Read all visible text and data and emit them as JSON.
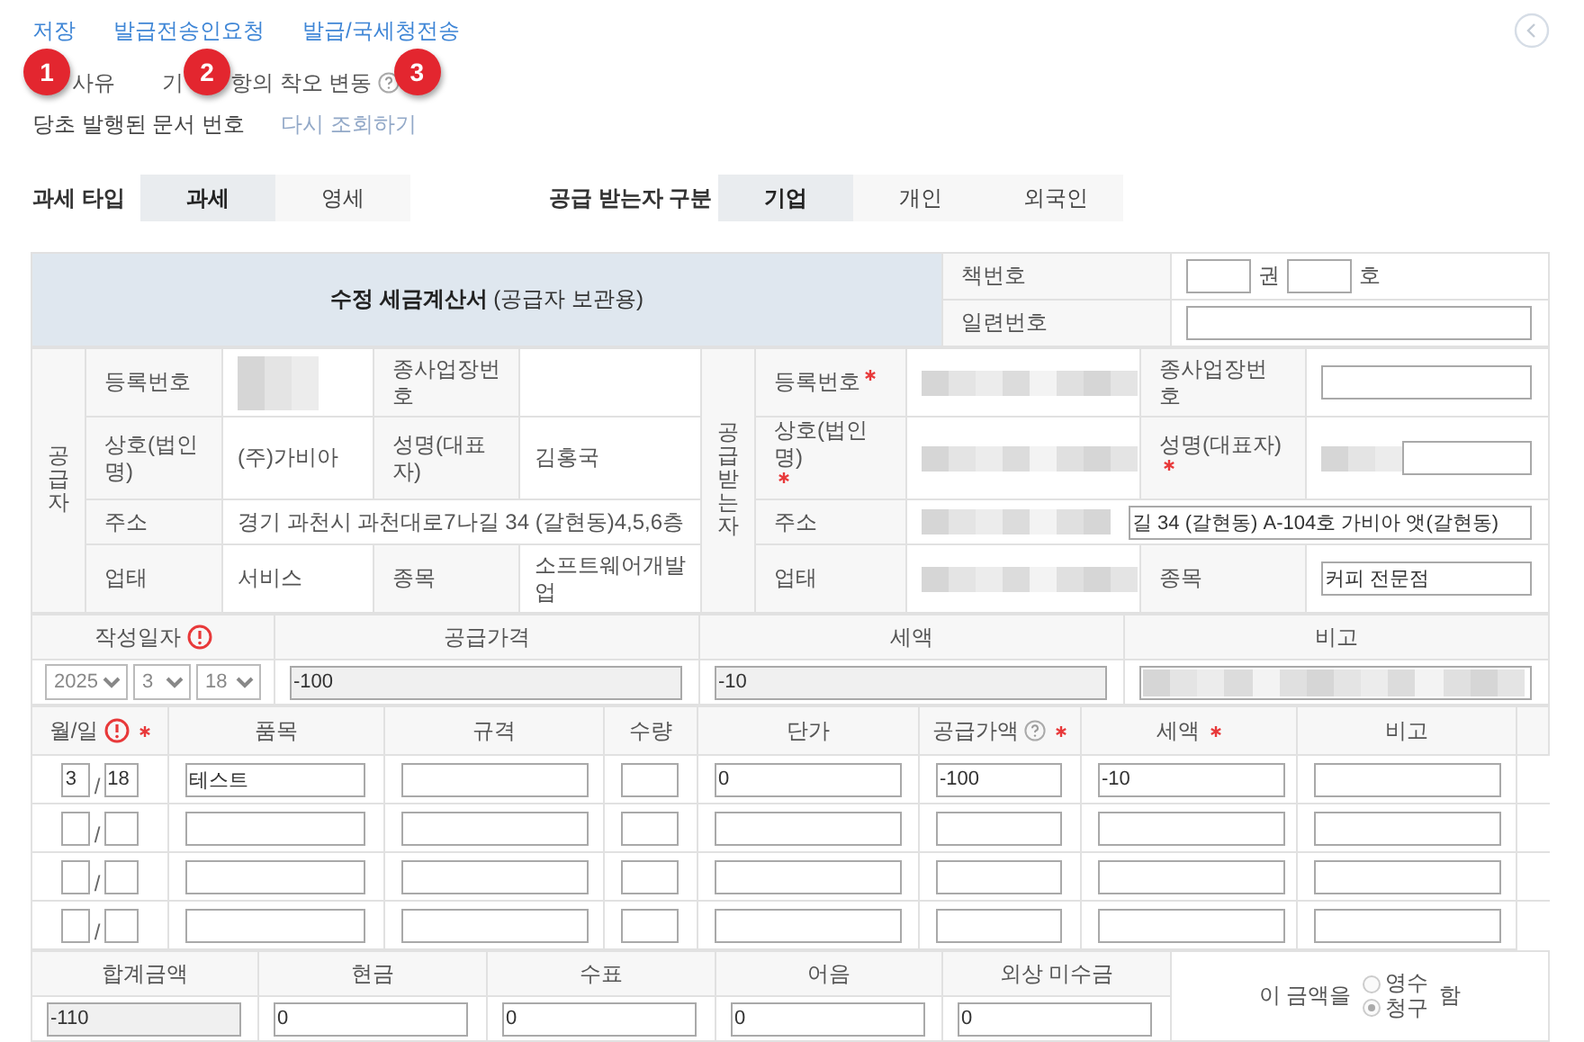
{
  "actions": [
    {
      "label": "저장"
    },
    {
      "label": "발급전송인요청"
    },
    {
      "label": "발급/국세청전송"
    }
  ],
  "callouts": [
    "1",
    "2",
    "3"
  ],
  "reason": {
    "texts": [
      "사유",
      "기",
      "항의 착오 변동"
    ],
    "help": true
  },
  "original_document": {
    "label": "당초 발행된 문서 번호",
    "link": "다시 조회하기"
  },
  "tax_type": {
    "label": "과세 타입",
    "options": [
      {
        "label": "과세",
        "selected": true
      },
      {
        "label": "영세",
        "selected": false
      }
    ]
  },
  "recipient_type": {
    "label": "공급 받는자 구분",
    "options": [
      {
        "label": "기업",
        "selected": true
      },
      {
        "label": "개인",
        "selected": false
      },
      {
        "label": "외국인",
        "selected": false
      }
    ]
  },
  "invoice": {
    "title": "**수정 세금계산서** (공급자 보관용)",
    "book_number": {
      "label": "책번호",
      "unit_1": "권",
      "unit_2": "호"
    },
    "serial_number": {
      "label": "일련번호"
    },
    "supplier": {
      "heading": "공급자",
      "rows": [
        [
          {
            "label": "등록번호",
            "kind": "blurred",
            "required": false
          },
          {
            "label": "종사업장번호",
            "kind": "empty",
            "required": false
          }
        ],
        [
          {
            "label": "상호(법인명)",
            "kind": "text",
            "value": "(주)가비아",
            "required": false
          },
          {
            "label": "성명(대표자)",
            "kind": "text",
            "value": "김홍국",
            "required": false
          }
        ],
        [
          {
            "label": "주소",
            "kind": "text",
            "value": "경기 과천시 과천대로7나길 34 (갈현동)4,5,6층",
            "required": false
          }
        ],
        [
          {
            "label": "업태",
            "kind": "text",
            "value": "서비스",
            "required": false
          },
          {
            "label": "종목",
            "kind": "text",
            "value": "소프트웨어개발업",
            "required": false
          }
        ]
      ]
    },
    "receiver": {
      "heading": "공급받는자",
      "rows": [
        [
          {
            "label": "등록번호",
            "kind": "blurred",
            "required": true
          },
          {
            "label": "종사업장번호",
            "kind": "input",
            "required": false
          }
        ],
        [
          {
            "label": "상호(법인명)",
            "kind": "blurred",
            "required": true
          },
          {
            "label": "성명(대표자)",
            "kind": "blurred_input",
            "required": true
          }
        ],
        [
          {
            "label": "주소",
            "kind": "blurred_input",
            "value": "길 34 (갈현동) A-104호 가비아 앳(갈현동)",
            "required": false
          }
        ],
        [
          {
            "label": "업태",
            "kind": "blurred",
            "required": false
          },
          {
            "label": "종목",
            "kind": "input",
            "value": "커피 전문점",
            "required": false
          }
        ]
      ]
    },
    "summary": {
      "columns": [
        {
          "label": "작성일자",
          "alert": true
        },
        {
          "label": "공급가격",
          "alert": false
        },
        {
          "label": "세액",
          "alert": false
        },
        {
          "label": "비고",
          "alert": false
        }
      ],
      "date": [
        "2025",
        "3",
        "18"
      ],
      "supply_price": {
        "value": "-100",
        "disabled": true
      },
      "tax": {
        "value": "-10",
        "disabled": true
      },
      "note": {
        "kind": "blurred"
      }
    },
    "items": {
      "columns": [
        {
          "label": "월/일",
          "alert": true,
          "help": false,
          "required": true
        },
        {
          "label": "품목",
          "alert": false,
          "help": false,
          "required": false
        },
        {
          "label": "규격",
          "alert": false,
          "help": false,
          "required": false
        },
        {
          "label": "수량",
          "alert": false,
          "help": false,
          "required": false
        },
        {
          "label": "단가",
          "alert": false,
          "help": false,
          "required": false
        },
        {
          "label": "공급가액",
          "alert": false,
          "help": true,
          "required": true
        },
        {
          "label": "세액",
          "alert": false,
          "help": false,
          "required": true
        },
        {
          "label": "비고",
          "alert": false,
          "help": false,
          "required": false
        }
      ],
      "rows": [
        {
          "month": "3",
          "separator": "/",
          "day": "18",
          "item": "테스트",
          "unit_price": "0",
          "supply_amount": "-100",
          "tax": "-10"
        },
        {
          "separator": "/"
        },
        {
          "separator": "/"
        },
        {
          "separator": "/"
        }
      ]
    },
    "totals": {
      "columns": [
        "합계금액",
        "현금",
        "수표",
        "어음",
        "외상 미수금"
      ],
      "values": [
        {
          "value": "-110",
          "disabled": true
        },
        {
          "value": "0",
          "disabled": false
        },
        {
          "value": "0",
          "disabled": false
        },
        {
          "value": "0",
          "disabled": false
        },
        {
          "value": "0",
          "disabled": false
        }
      ]
    },
    "payment": {
      "prefix": "이 금액을",
      "options": [
        {
          "label": "영수",
          "selected": false
        },
        {
          "label": "청구",
          "selected": true
        }
      ],
      "suffix": "함"
    }
  }
}
